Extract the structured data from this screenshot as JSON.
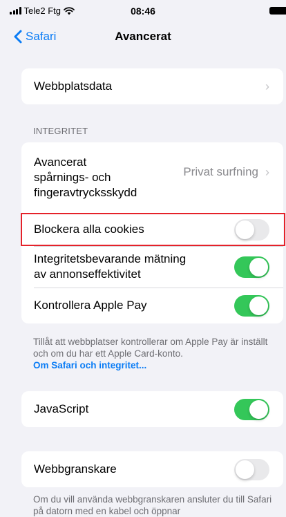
{
  "status_bar": {
    "carrier": "Tele2 Ftg",
    "time": "08:46"
  },
  "nav": {
    "back_label": "Safari",
    "title": "Avancerat"
  },
  "website_data": {
    "label": "Webbplatsdata"
  },
  "privacy": {
    "header": "INTEGRITET",
    "tracking": {
      "label_line1": "Avancerat",
      "label_line2": "spårnings- och",
      "label_line3": "fingeravtrycksskydd",
      "value": "Privat surfning"
    },
    "block_cookies": {
      "label": "Blockera alla cookies",
      "enabled": false
    },
    "ad_measurement": {
      "label_line1": "Integritetsbevarande mätning",
      "label_line2": "av annonseffektivitet",
      "enabled": true
    },
    "apple_pay": {
      "label": "Kontrollera Apple Pay",
      "enabled": true
    },
    "footer_text": "Tillåt att webbplatser kontrollerar om Apple Pay är inställt och om du har ett Apple Card-konto.",
    "footer_link": "Om Safari och integritet..."
  },
  "javascript": {
    "label": "JavaScript",
    "enabled": true
  },
  "web_inspector": {
    "label": "Webbgranskare",
    "enabled": false,
    "footer_text": "Om du vill använda webbgranskaren ansluter du till Safari på datorn med en kabel och öppnar"
  },
  "colors": {
    "accent": "#0a7cf5",
    "toggle_on": "#34c759",
    "highlight": "#e5222a"
  }
}
